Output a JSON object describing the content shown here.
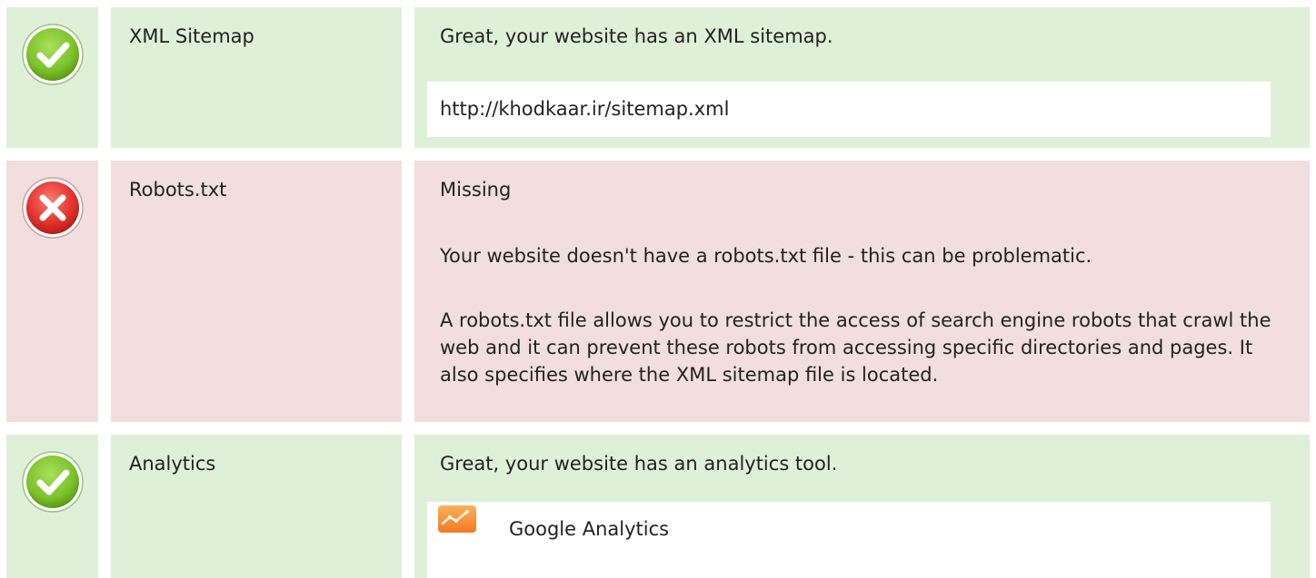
{
  "rows": [
    {
      "status": "pass",
      "icon": "check-circle-icon",
      "name": "XML Sitemap",
      "message": "Great, your website has an XML sitemap.",
      "detail": "http://khodkaar.ir/sitemap.xml"
    },
    {
      "status": "fail",
      "icon": "x-circle-icon",
      "name": "Robots.txt",
      "message": "Missing",
      "paragraphs": [
        "Your website doesn't have a robots.txt file - this can be problematic.",
        "A robots.txt file allows you to restrict the access of search engine robots that crawl the web and it can prevent these robots from accessing specific directories and pages. It also specifies where the XML sitemap file is located."
      ]
    },
    {
      "status": "pass",
      "icon": "check-circle-icon",
      "name": "Analytics",
      "message": "Great, your website has an analytics tool.",
      "tool": {
        "icon": "google-analytics-icon",
        "label": "Google Analytics"
      }
    }
  ],
  "colors": {
    "pass_bg": "#dff0d8",
    "fail_bg": "#f2dede",
    "pass_icon": "#7cc22b",
    "fail_icon": "#e0302b",
    "analytics_icon": "#f4912f"
  }
}
